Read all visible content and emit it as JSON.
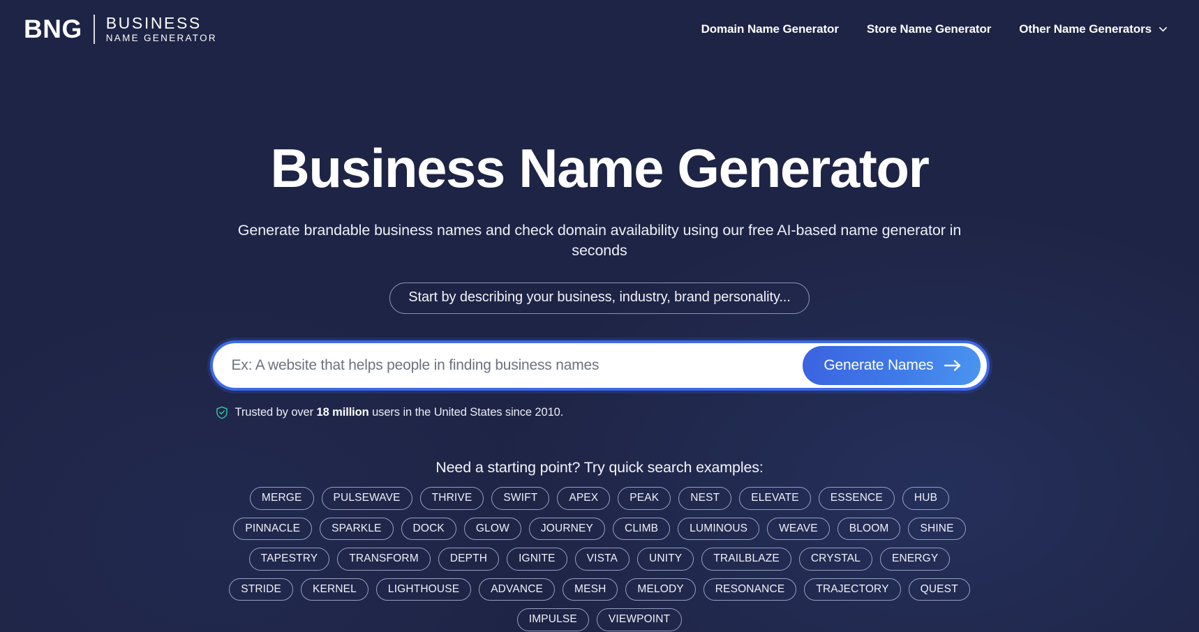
{
  "header": {
    "logo": {
      "mark": "BNG",
      "line1": "BUSINESS",
      "line2": "NAME GENERATOR"
    },
    "nav": [
      {
        "label": "Domain Name Generator",
        "has_dropdown": false
      },
      {
        "label": "Store Name Generator",
        "has_dropdown": false
      },
      {
        "label": "Other Name Generators",
        "has_dropdown": true
      }
    ]
  },
  "hero": {
    "title": "Business Name Generator",
    "subtitle": "Generate brandable business names and check domain availability using our free AI-based name generator in seconds",
    "hint_pill": "Start by describing your business, industry, brand personality..."
  },
  "search": {
    "placeholder": "Ex: A website that helps people in finding business names",
    "value": "",
    "button_label": "Generate Names",
    "button_icon": "arrow-right-icon"
  },
  "trust": {
    "icon": "shield-check-icon",
    "icon_color": "#34c49a",
    "prefix": "Trusted by over ",
    "highlight": "18 million",
    "suffix": " users in the United States since 2010."
  },
  "examples": {
    "heading": "Need a starting point? Try quick search examples:",
    "rows": [
      [
        "MERGE",
        "PULSEWAVE",
        "THRIVE",
        "SWIFT",
        "APEX",
        "PEAK",
        "NEST",
        "ELEVATE",
        "ESSENCE",
        "HUB"
      ],
      [
        "PINNACLE",
        "SPARKLE",
        "DOCK",
        "GLOW",
        "JOURNEY",
        "CLIMB",
        "LUMINOUS",
        "WEAVE",
        "BLOOM",
        "SHINE"
      ],
      [
        "TAPESTRY",
        "TRANSFORM",
        "DEPTH",
        "IGNITE",
        "VISTA",
        "UNITY",
        "TRAILBLAZE",
        "CRYSTAL",
        "ENERGY"
      ],
      [
        "STRIDE",
        "KERNEL",
        "LIGHTHOUSE",
        "ADVANCE",
        "MESH",
        "MELODY",
        "RESONANCE",
        "TRAJECTORY",
        "QUEST"
      ],
      [
        "IMPULSE",
        "VIEWPOINT"
      ]
    ]
  },
  "theme": {
    "background": "#1e2445",
    "accent": "#3d6ae8",
    "accent_light": "#4a95f0",
    "text": "#ffffff",
    "tag_border": "#98a0c2"
  }
}
